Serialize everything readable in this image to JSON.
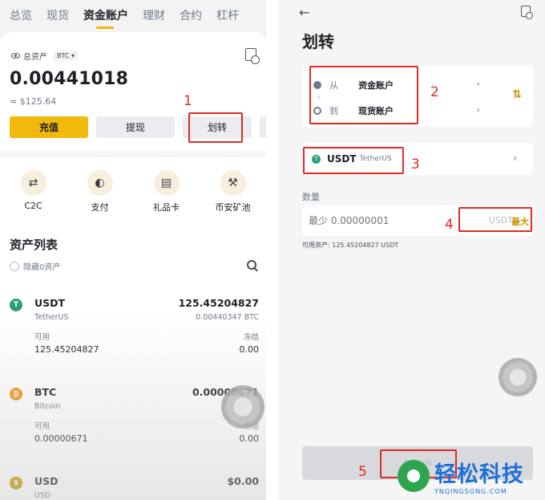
{
  "left": {
    "top_tabs": [
      "总览",
      "现货",
      "资金账户",
      "理财",
      "合约",
      "杠杆"
    ],
    "active_tab_index": 2,
    "total_assets_label": "总资产",
    "coin_select": "BTC",
    "balance": "0.00441018",
    "fiat_value": "≈ $125.64",
    "buttons": {
      "deposit": "充值",
      "withdraw": "提现",
      "transfer": "划转"
    },
    "shortcuts": [
      {
        "label": "C2C",
        "icon": "c2c-icon"
      },
      {
        "label": "支付",
        "icon": "pay-icon"
      },
      {
        "label": "礼品卡",
        "icon": "gift-card-icon"
      },
      {
        "label": "币安矿池",
        "icon": "mining-pool-icon"
      }
    ],
    "assets_title": "资产列表",
    "hide_zero_label": "隐藏0资产",
    "assets": [
      {
        "symbol": "USDT",
        "name": "TetherUS",
        "total": "125.45204827",
        "btc_value": "0.00440347 BTC",
        "available_label": "可用",
        "frozen_label": "冻结",
        "available": "125.45204827",
        "frozen": "0.00",
        "color": "#26a17b"
      },
      {
        "symbol": "BTC",
        "name": "Bitcoin",
        "total": "0.00000671",
        "btc_value": "",
        "available_label": "可用",
        "frozen_label": "冻结",
        "available": "0.00000671",
        "frozen": "0.00",
        "color": "#f7931a"
      },
      {
        "symbol": "USD",
        "name": "USD",
        "total": "$0.00",
        "btc_value": "",
        "available_label": "",
        "frozen_label": "",
        "available": "",
        "frozen": "",
        "color": "#c99400"
      }
    ]
  },
  "right": {
    "title": "划转",
    "from_label": "从",
    "from_value": "资金账户",
    "to_label": "到",
    "to_value": "现货账户",
    "coin_symbol": "USDT",
    "coin_name": "TetherUS",
    "quantity_label": "数量",
    "quantity_placeholder": "最少 0.00000001",
    "quantity_unit": "USDT",
    "max_label": "最大",
    "available_text": "可用资产: 125.45204827 USDT",
    "confirm_label": "确认划转"
  },
  "annotations": [
    "1",
    "2",
    "3",
    "4",
    "5"
  ],
  "watermark": {
    "cn": "轻松科技",
    "en": "YNQINGSONG.COM"
  },
  "colors": {
    "accent": "#f0b90b",
    "annotation": "#e02a24",
    "watermark": "#1e6fd9"
  }
}
